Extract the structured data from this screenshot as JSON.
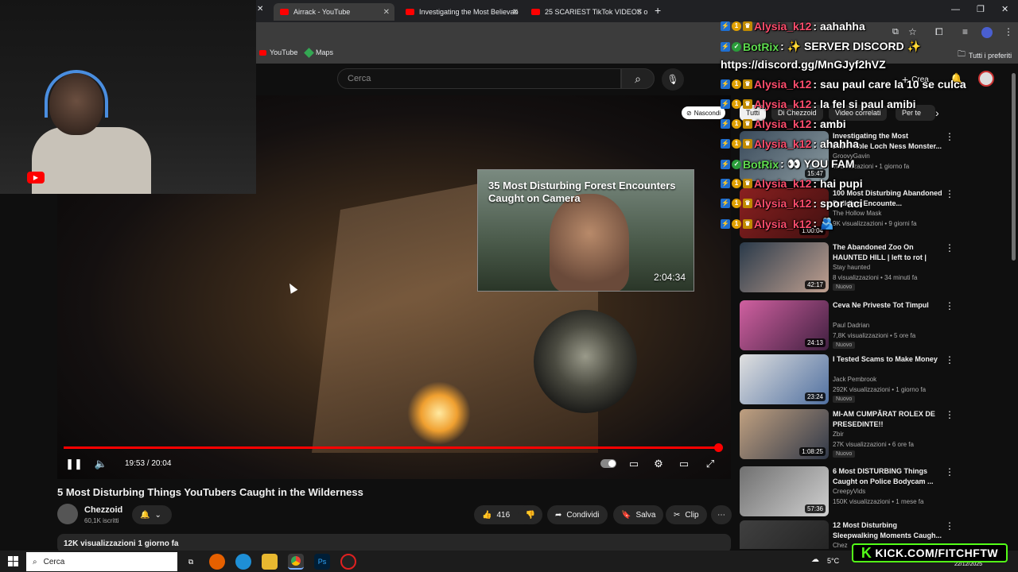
{
  "browser": {
    "tabs": [
      {
        "label": "Airrack - YouTube"
      },
      {
        "label": "Investigating the Most Believab"
      },
      {
        "label": "25 SCARIEST TikTok VIDEOS of"
      }
    ],
    "new_tab": "+",
    "bookmarks": [
      {
        "label": "YouTube"
      },
      {
        "label": "Maps"
      }
    ],
    "all_bookmarks": "Tutti i preferiti"
  },
  "youtube": {
    "search_placeholder": "Cerca",
    "create_label": "Crea",
    "hide_label": "Nascondi",
    "video": {
      "title": "5 Most Disturbing Things YouTubers Caught in the Wilderness",
      "current_time": "19:53 / 20:04",
      "progress": 0.991,
      "endcard_title": "35 Most Disturbing Forest Encounters Caught on Camera",
      "endcard_duration": "2:04:34"
    },
    "channel": {
      "name": "Chezzoid",
      "subscribers": "60,1K iscritti"
    },
    "actions": {
      "likes": "416",
      "share": "Condividi",
      "save": "Salva",
      "clip": "Clip"
    },
    "description_meta": "12K visualizzazioni  1 giorno fa",
    "chips": [
      "Tutti",
      "Di Chezzoid",
      "Video correlati",
      "Per te"
    ],
    "recommendations": [
      {
        "title": "Investigating the Most Believable Loch Ness Monster...",
        "channel": "GroovyGavin",
        "meta": "visualizzazioni • 1 giorno fa",
        "duration": "15:47",
        "badge": ""
      },
      {
        "title": "100 Most Disturbing Abandoned Building Encounte...",
        "channel": "The Hollow Mask",
        "meta": "9K visualizzazioni • 9 giorni fa",
        "duration": "1:00:04",
        "badge": ""
      },
      {
        "title": "The Abandoned Zoo On HAUNTED HILL | left to rot | thi...",
        "channel": "Stay haunted",
        "meta": "8 visualizzazioni • 34 minuti fa",
        "duration": "42:17",
        "badge": "Nuovo"
      },
      {
        "title": "Ceva Ne Priveste Tot Timpul",
        "channel": "Paul Dadrian",
        "meta": "7,8K visualizzazioni • 5 ore fa",
        "duration": "24:13",
        "badge": "Nuovo"
      },
      {
        "title": "I Tested Scams to Make Money",
        "channel": "Jack Pembrook",
        "meta": "292K visualizzazioni • 1 giorno fa",
        "duration": "23:24",
        "badge": "Nuovo"
      },
      {
        "title": "MI-AM CUMPĂRAT ROLEX DE PRESEDINTE!!",
        "channel": "Zbir",
        "meta": "27K visualizzazioni • 6 ore fa",
        "duration": "1:08:25",
        "badge": "Nuovo"
      },
      {
        "title": "6 Most DISTURBING Things Caught on Police Bodycam ...",
        "channel": "CreepyVids",
        "meta": "150K visualizzazioni • 1 mese fa",
        "duration": "57:36",
        "badge": ""
      },
      {
        "title": "12 Most Disturbing Sleepwalking Moments Caugh...",
        "channel": "Chez",
        "meta": "",
        "duration": "",
        "badge": ""
      }
    ]
  },
  "stream_overlay": {
    "chat": [
      {
        "user": "Alysia_k12",
        "color": "pink",
        "message": ": aahahha"
      },
      {
        "user": "BotRix",
        "color": "green",
        "message": ": ✨ SERVER DISCORD ✨"
      },
      {
        "user": "",
        "color": "none",
        "message": "https://discord.gg/MnGJyf2hVZ"
      },
      {
        "user": "Alysia_k12",
        "color": "pink",
        "message": ": sau paul care la 10 se culca"
      },
      {
        "user": "Alysia_k12",
        "color": "pink",
        "message": ": la fel si paul amibi"
      },
      {
        "user": "Alysia_k12",
        "color": "pink",
        "message": ": ambi"
      },
      {
        "user": "Alysia_k12",
        "color": "pink",
        "message": ": ahahha"
      },
      {
        "user": "BotRix",
        "color": "green",
        "message": ": 👀 YOU FAM"
      },
      {
        "user": "Alysia_k12",
        "color": "pink",
        "message": ": hai pupi"
      },
      {
        "user": "Alysia_k12",
        "color": "pink",
        "message": ": spor aci"
      },
      {
        "user": "Alysia_k12",
        "color": "pink",
        "message": ": 🫂"
      }
    ],
    "kick_url": "KICK.COM/FITCHFTW"
  },
  "taskbar": {
    "search_placeholder": "Cerca",
    "weather": "5°C",
    "date": "22/12/2025"
  }
}
